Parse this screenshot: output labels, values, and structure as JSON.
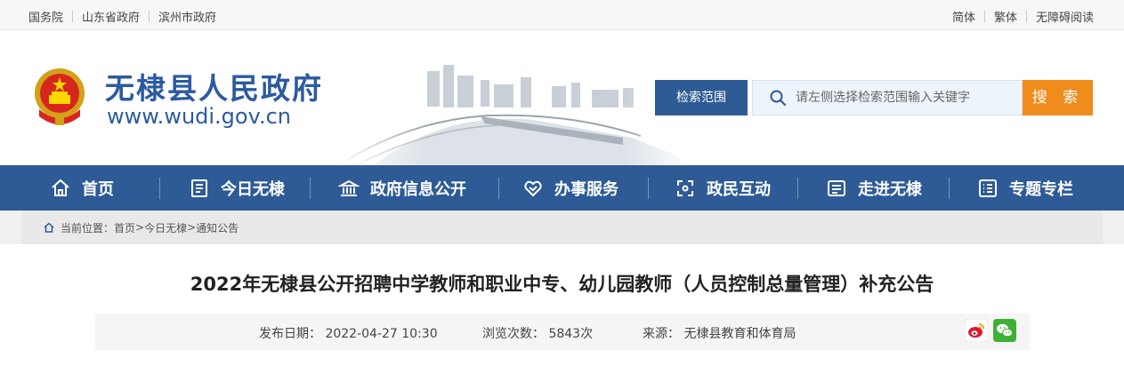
{
  "topbar": {
    "left_links": [
      "国务院",
      "山东省政府",
      "滨州市政府"
    ],
    "right_links": [
      "简体",
      "繁体",
      "无障碍阅读"
    ]
  },
  "header": {
    "title": "无棣县人民政府",
    "url": "www.wudi.gov.cn",
    "scope_label": "检索范围",
    "search_placeholder": "请左侧选择检索范围输入关键字",
    "search_button": "搜 索"
  },
  "nav": {
    "items": [
      "首页",
      "今日无棣",
      "政府信息公开",
      "办事服务",
      "政民互动",
      "走进无棣",
      "专题专栏"
    ]
  },
  "breadcrumb": {
    "prefix": "当前位置：",
    "items": [
      "首页",
      "今日无棣",
      "通知公告"
    ],
    "sep": ">"
  },
  "article": {
    "title": "2022年无棣县公开招聘中学教师和职业中专、幼儿园教师（人员控制总量管理）补充公告",
    "publish_time": "发布日期：  2022-04-27 10:30",
    "views": "浏览次数：  5843次",
    "source": "来源：  无棣县教育和体育局"
  },
  "colors": {
    "brand_blue": "#2e5b95",
    "title_blue": "#2c5aa0",
    "search_orange": "#f08c1c"
  },
  "icons": [
    "emblem",
    "search-icon",
    "home-icon",
    "news-icon",
    "government-icon",
    "service-icon",
    "interaction-icon",
    "intro-icon",
    "topic-icon",
    "location-icon",
    "weibo-icon",
    "wechat-icon"
  ]
}
